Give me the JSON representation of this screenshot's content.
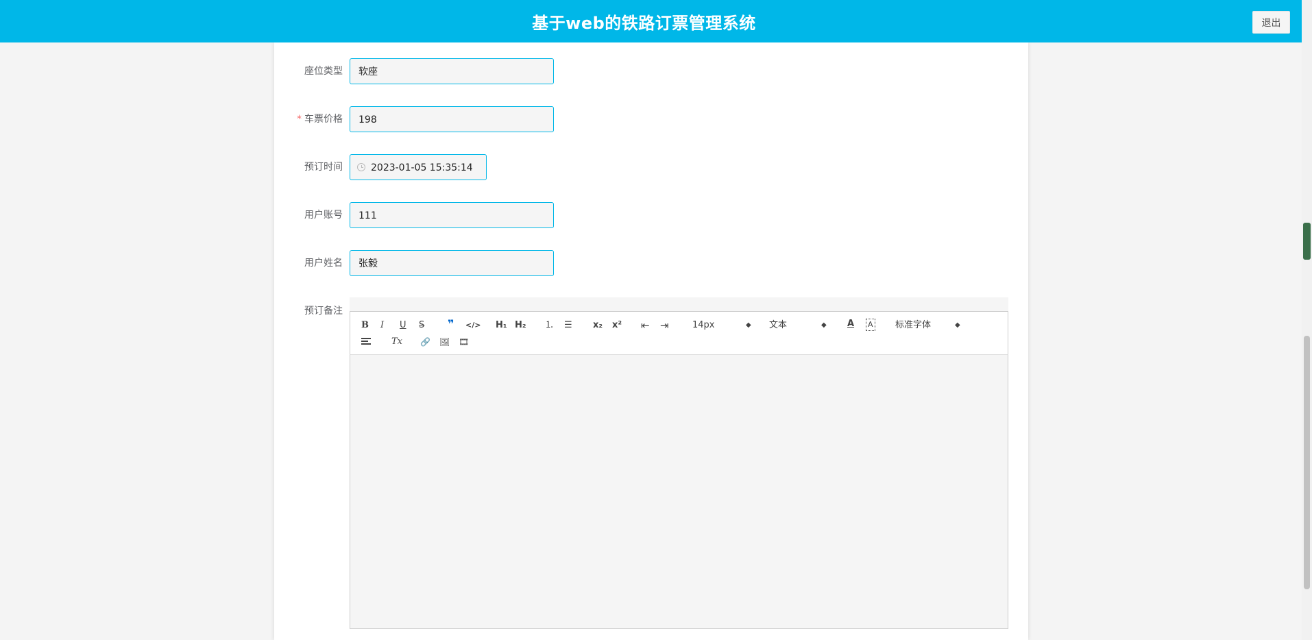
{
  "header": {
    "title": "基于web的铁路订票管理系统",
    "logout_label": "退出"
  },
  "form": {
    "seat_type": {
      "label": "座位类型",
      "value": "软座"
    },
    "price": {
      "required_mark": "*",
      "label": "车票价格",
      "value": "198"
    },
    "booking_time": {
      "label": "预订时间",
      "value": "2023-01-05 15:35:14"
    },
    "user_account": {
      "label": "用户账号",
      "value": "111"
    },
    "user_name": {
      "label": "用户姓名",
      "value": "张毅"
    },
    "remark": {
      "label": "预订备注"
    }
  },
  "editor": {
    "toolbar": {
      "bold": "B",
      "italic": "I",
      "underline": "U",
      "strike": "S",
      "quote": "❞",
      "code": "</>",
      "h1": "H₁",
      "h2": "H₂",
      "ordered_list": "⒈",
      "bullet_list": "☰",
      "subscript": "x₂",
      "superscript": "x²",
      "outdent": "⇤",
      "indent": "⇥",
      "font_size": "14px",
      "heading_select": "文本",
      "font_family": "标准字体",
      "font_color": "A",
      "background_color": "A",
      "clean": "Tx",
      "link": "🔗",
      "image": "🖼",
      "video": "🎞"
    }
  }
}
